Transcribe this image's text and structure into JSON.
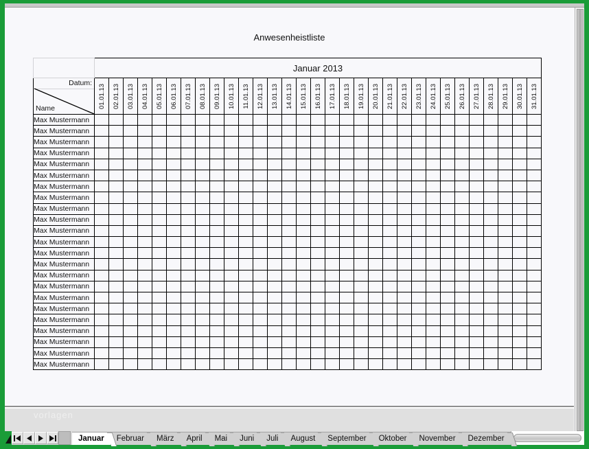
{
  "window": {
    "accent_green": "#1a9c38",
    "sheet_background": "#f8f8fb"
  },
  "document": {
    "title": "Anwesenheistliste",
    "month_header": "Januar 2013",
    "corner": {
      "top_label": "Datum:",
      "bottom_label": "Name"
    },
    "date_columns": [
      "01.01.13",
      "02.01.13",
      "03.01.13",
      "04.01.13",
      "05.01.13",
      "06.01.13",
      "07.01.13",
      "08.01.13",
      "09.01.13",
      "10.01.13",
      "11.01.13",
      "12.01.13",
      "13.01.13",
      "14.01.13",
      "15.01.13",
      "16.01.13",
      "17.01.13",
      "18.01.13",
      "19.01.13",
      "20.01.13",
      "21.01.13",
      "22.01.13",
      "23.01.13",
      "24.01.13",
      "25.01.13",
      "26.01.13",
      "27.01.13",
      "28.01.13",
      "29.01.13",
      "30.01.13",
      "31.01.13"
    ],
    "rows": [
      {
        "name": "Max Mustermann"
      },
      {
        "name": "Max Mustermann"
      },
      {
        "name": "Max Mustermann"
      },
      {
        "name": "Max Mustermann"
      },
      {
        "name": "Max Mustermann"
      },
      {
        "name": "Max Mustermann"
      },
      {
        "name": "Max Mustermann"
      },
      {
        "name": "Max Mustermann"
      },
      {
        "name": "Max Mustermann"
      },
      {
        "name": "Max Mustermann"
      },
      {
        "name": "Max Mustermann"
      },
      {
        "name": "Max Mustermann"
      },
      {
        "name": "Max Mustermann"
      },
      {
        "name": "Max Mustermann"
      },
      {
        "name": "Max Mustermann"
      },
      {
        "name": "Max Mustermann"
      },
      {
        "name": "Max Mustermann"
      },
      {
        "name": "Max Mustermann"
      },
      {
        "name": "Max Mustermann"
      },
      {
        "name": "Max Mustermann"
      },
      {
        "name": "Max Mustermann"
      },
      {
        "name": "Max Mustermann"
      },
      {
        "name": "Max Mustermann"
      }
    ]
  },
  "status": {
    "watermark": "vorlagen"
  },
  "sheet_nav": {
    "first_icon": "first-sheet-icon",
    "prev_icon": "previous-sheet-icon",
    "next_icon": "next-sheet-icon",
    "last_icon": "last-sheet-icon"
  },
  "tabs": {
    "active": "Januar",
    "items": [
      "Januar",
      "Februar",
      "März",
      "April",
      "Mai",
      "Juni",
      "Juli",
      "August",
      "September",
      "Oktober",
      "November",
      "Dezember"
    ]
  }
}
